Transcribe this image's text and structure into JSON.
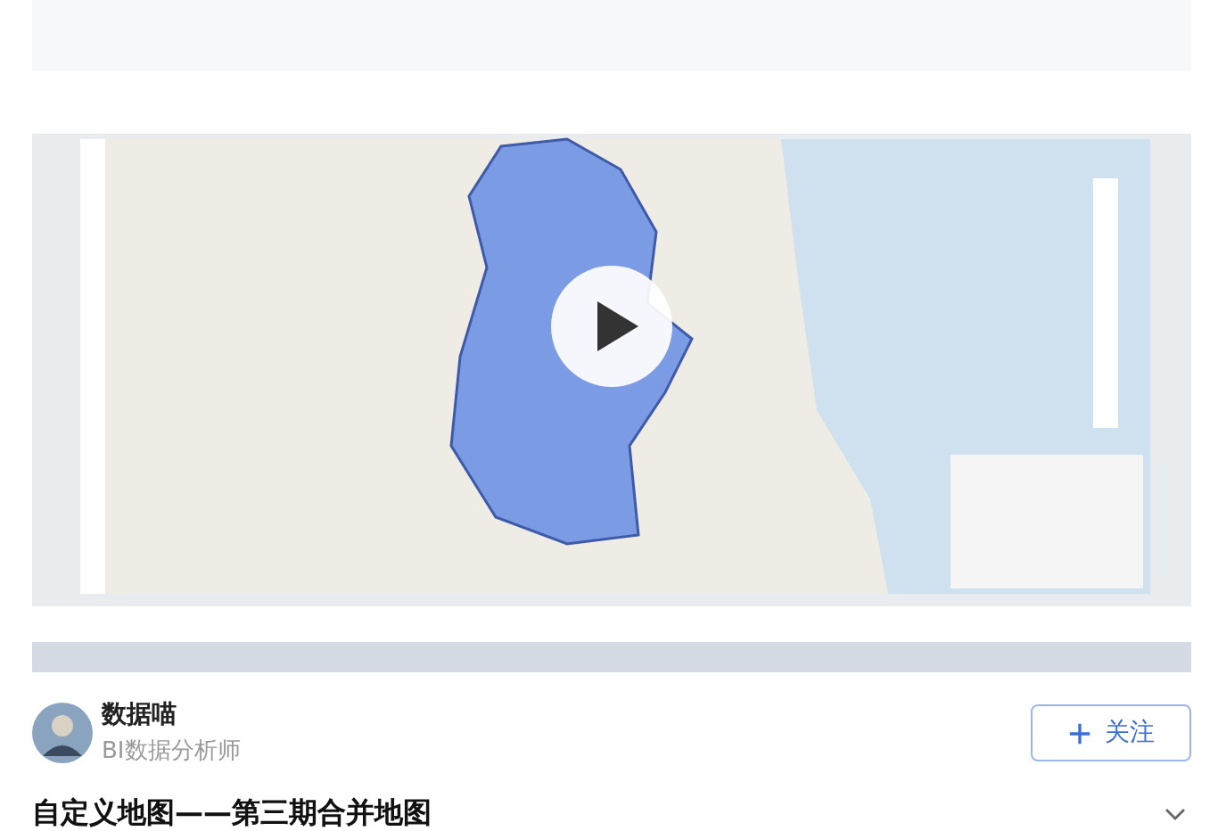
{
  "author": {
    "name": "数据喵",
    "role": "BI数据分析师"
  },
  "follow_button": {
    "label": "关注"
  },
  "title": "自定义地图——第三期合并地图"
}
